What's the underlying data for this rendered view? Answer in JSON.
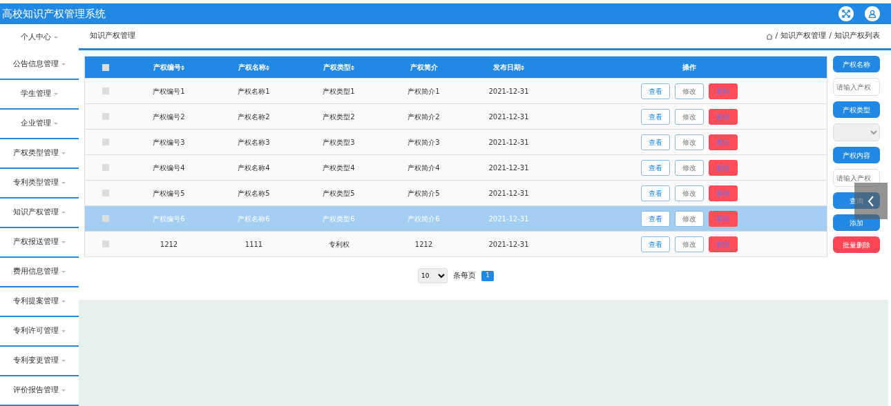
{
  "header": {
    "title": "高校知识产权管理系统"
  },
  "sidebar": {
    "items": [
      {
        "label": "个人中心",
        "expanded": false
      },
      {
        "label": "公告信息管理",
        "expanded": false
      },
      {
        "label": "学生管理",
        "expanded": false
      },
      {
        "label": "企业管理",
        "expanded": false
      },
      {
        "label": "产权类型管理",
        "expanded": false
      },
      {
        "label": "专利类型管理",
        "expanded": false
      },
      {
        "label": "知识产权管理",
        "expanded": false
      },
      {
        "label": "产权报送管理",
        "expanded": false
      },
      {
        "label": "费用信息管理",
        "expanded": false
      },
      {
        "label": "专利提案管理",
        "expanded": false
      },
      {
        "label": "专利许可管理",
        "expanded": false
      },
      {
        "label": "专利变更管理",
        "expanded": false
      },
      {
        "label": "评价报告管理",
        "expanded": false
      }
    ]
  },
  "page_title": "知识产权管理",
  "breadcrumb": [
    {
      "separator": "/",
      "label": "知识产权管理"
    },
    {
      "separator": "/",
      "label": "知识产权列表"
    }
  ],
  "table": {
    "all_checked": false,
    "columns": [
      {
        "label": "产权编号",
        "sortable": true
      },
      {
        "label": "产权名称",
        "sortable": true
      },
      {
        "label": "产权类型",
        "sortable": true
      },
      {
        "label": "产权简介",
        "sortable": false
      },
      {
        "label": "发布日期",
        "sortable": true
      },
      {
        "label": "操作",
        "sortable": false
      }
    ],
    "rows": [
      {
        "cells": [
          "产权编号1",
          "产权名称1",
          "产权类型1",
          "产权简介1",
          "2021-12-31"
        ],
        "checked": false,
        "selected": false,
        "actions": [
          {
            "label": "查看",
            "kind": "view"
          },
          {
            "label": "修改",
            "kind": "edit"
          },
          {
            "label": "删除",
            "kind": "delete"
          }
        ]
      },
      {
        "cells": [
          "产权编号2",
          "产权名称2",
          "产权类型2",
          "产权简介2",
          "2021-12-31"
        ],
        "checked": false,
        "selected": false,
        "actions": [
          {
            "label": "查看",
            "kind": "view"
          },
          {
            "label": "修改",
            "kind": "edit"
          },
          {
            "label": "删除",
            "kind": "delete"
          }
        ]
      },
      {
        "cells": [
          "产权编号3",
          "产权名称3",
          "产权类型3",
          "产权简介3",
          "2021-12-31"
        ],
        "checked": false,
        "selected": false,
        "actions": [
          {
            "label": "查看",
            "kind": "view"
          },
          {
            "label": "修改",
            "kind": "edit"
          },
          {
            "label": "删除",
            "kind": "delete"
          }
        ]
      },
      {
        "cells": [
          "产权编号4",
          "产权名称4",
          "产权类型4",
          "产权简介4",
          "2021-12-31"
        ],
        "checked": false,
        "selected": false,
        "actions": [
          {
            "label": "查看",
            "kind": "view"
          },
          {
            "label": "修改",
            "kind": "edit"
          },
          {
            "label": "删除",
            "kind": "delete"
          }
        ]
      },
      {
        "cells": [
          "产权编号5",
          "产权名称5",
          "产权类型5",
          "产权简介5",
          "2021-12-31"
        ],
        "checked": false,
        "selected": false,
        "actions": [
          {
            "label": "查看",
            "kind": "view"
          },
          {
            "label": "修改",
            "kind": "edit"
          },
          {
            "label": "删除",
            "kind": "delete"
          }
        ]
      },
      {
        "cells": [
          "产权编号6",
          "产权名称6",
          "产权类型6",
          "产权简介6",
          "2021-12-31"
        ],
        "checked": false,
        "selected": true,
        "actions": [
          {
            "label": "查看",
            "kind": "view"
          },
          {
            "label": "修改",
            "kind": "edit"
          },
          {
            "label": "删除",
            "kind": "delete"
          }
        ]
      },
      {
        "cells": [
          "1212",
          "1111",
          "专利权",
          "1212",
          "2021-12-31"
        ],
        "checked": false,
        "selected": false,
        "actions": [
          {
            "label": "查看",
            "kind": "view"
          },
          {
            "label": "修改",
            "kind": "edit"
          },
          {
            "label": "删除",
            "kind": "delete"
          }
        ]
      }
    ]
  },
  "pagination": {
    "page_size": "10",
    "per_page_label": "条每页",
    "pages": [
      {
        "label": "1",
        "selected": true
      }
    ]
  },
  "search_panel": [
    {
      "kind": "label",
      "text": "产权名称"
    },
    {
      "kind": "input",
      "placeholder": "请输入产权"
    },
    {
      "kind": "label",
      "text": "产权类型"
    },
    {
      "kind": "select"
    },
    {
      "kind": "label",
      "text": "产权内容"
    },
    {
      "kind": "input",
      "placeholder": "请输入产权"
    },
    {
      "kind": "button",
      "text": "查询"
    },
    {
      "kind": "button",
      "text": "添加"
    },
    {
      "kind": "danger",
      "text": "批量删除"
    }
  ]
}
